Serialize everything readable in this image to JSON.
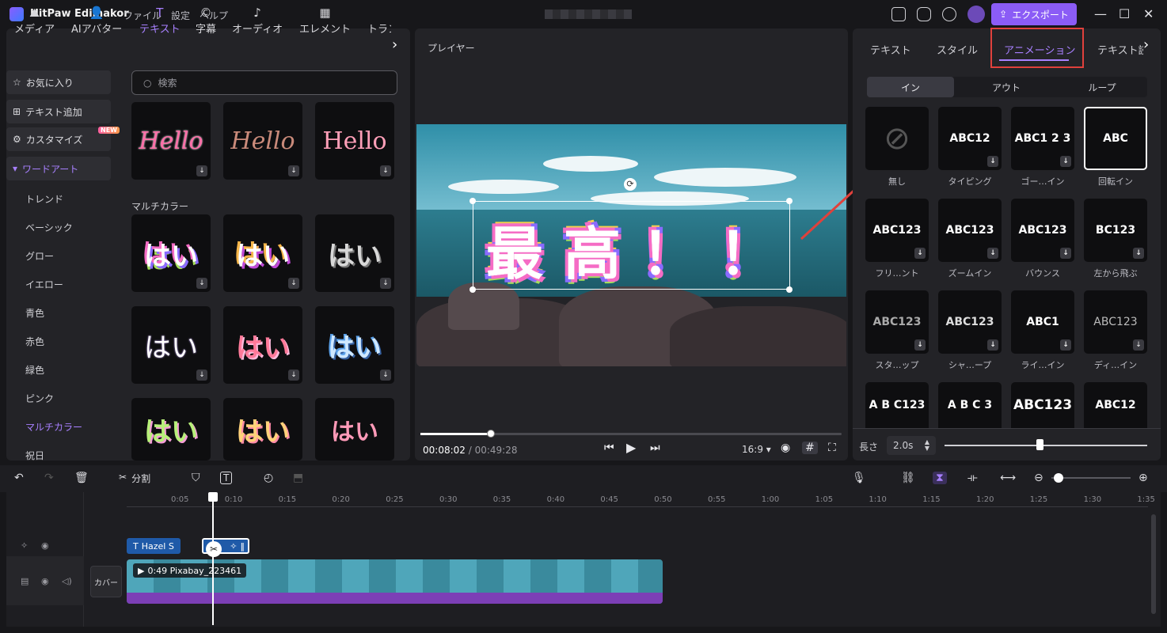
{
  "app": {
    "name": "HitPaw Edimakor",
    "menus": [
      "ファイル",
      "設定",
      "ヘルプ"
    ],
    "export_label": "エクスポート"
  },
  "left": {
    "tabs": [
      {
        "label": "メディア",
        "icon": "media-icon"
      },
      {
        "label": "AIアバター",
        "icon": "avatar-icon"
      },
      {
        "label": "テキスト",
        "icon": "text-icon"
      },
      {
        "label": "字幕",
        "icon": "caption-icon"
      },
      {
        "label": "オーディオ",
        "icon": "audio-icon"
      },
      {
        "label": "エレメント",
        "icon": "element-icon"
      },
      {
        "label": "トラン",
        "icon": "transition-icon"
      }
    ],
    "side": [
      "お気に入り",
      "テキスト追加",
      "カスタマイズ",
      "ワードアート"
    ],
    "new_badge": "NEW",
    "sub": [
      "トレンド",
      "ベーシック",
      "グロー",
      "イエロー",
      "青色",
      "赤色",
      "緑色",
      "ピンク",
      "マルチカラー",
      "祝日"
    ],
    "search_placeholder": "検索",
    "section_title": "マルチカラー",
    "hello_cards": [
      "Hello",
      "Hello",
      "Hello"
    ],
    "hai_cards": [
      "はい",
      "はい",
      "はい",
      "はい",
      "はい",
      "はい",
      "はい",
      "はい",
      "はい"
    ]
  },
  "player": {
    "title": "プレイヤー",
    "overlay_text": "最高！！",
    "current_time": "00:08:02",
    "total_time": "/ 00:49:28",
    "aspect": "16:9",
    "progress": 0.167
  },
  "right": {
    "tabs": [
      "テキスト",
      "スタイル",
      "アニメーション",
      "テキスト読"
    ],
    "segments": [
      "イン",
      "アウト",
      "ループ"
    ],
    "animations": [
      {
        "preview": "",
        "label": "無し"
      },
      {
        "preview": "ABC12",
        "label": "タイピング"
      },
      {
        "preview": "ABC1 2 3",
        "label": "ゴー…イン"
      },
      {
        "preview": "ABC",
        "label": "回転イン"
      },
      {
        "preview": "ABC123",
        "label": "フリ…ント"
      },
      {
        "preview": "ABC123",
        "label": "ズームイン"
      },
      {
        "preview": "ABC123",
        "label": "バウンス"
      },
      {
        "preview": "BC123",
        "label": "左から飛ぶ"
      },
      {
        "preview": "ABC123",
        "label": "スタ…ップ"
      },
      {
        "preview": "ABC123",
        "label": "シャ…ープ"
      },
      {
        "preview": "ABC1",
        "label": "ライ…イン"
      },
      {
        "preview": "ABC123",
        "label": "ディ…イン"
      },
      {
        "preview": "A B C123",
        "label": ""
      },
      {
        "preview": "A B C 3",
        "label": ""
      },
      {
        "preview": "ABC123",
        "label": ""
      },
      {
        "preview": "ABC12",
        "label": ""
      }
    ],
    "length_label": "長さ",
    "length_value": "2.0s"
  },
  "timeline": {
    "split_label": "分割",
    "ruler": [
      "0:05",
      "0:10",
      "0:15",
      "0:20",
      "0:25",
      "0:30",
      "0:35",
      "0:40",
      "0:45",
      "0:50",
      "0:55",
      "1:00",
      "1:05",
      "1:10",
      "1:15",
      "1:20",
      "1:25",
      "1:30",
      "1:35"
    ],
    "text_clip": "Hazel S",
    "video_clip": "0:49 Pixabay_223461",
    "cover_label": "カバー"
  }
}
